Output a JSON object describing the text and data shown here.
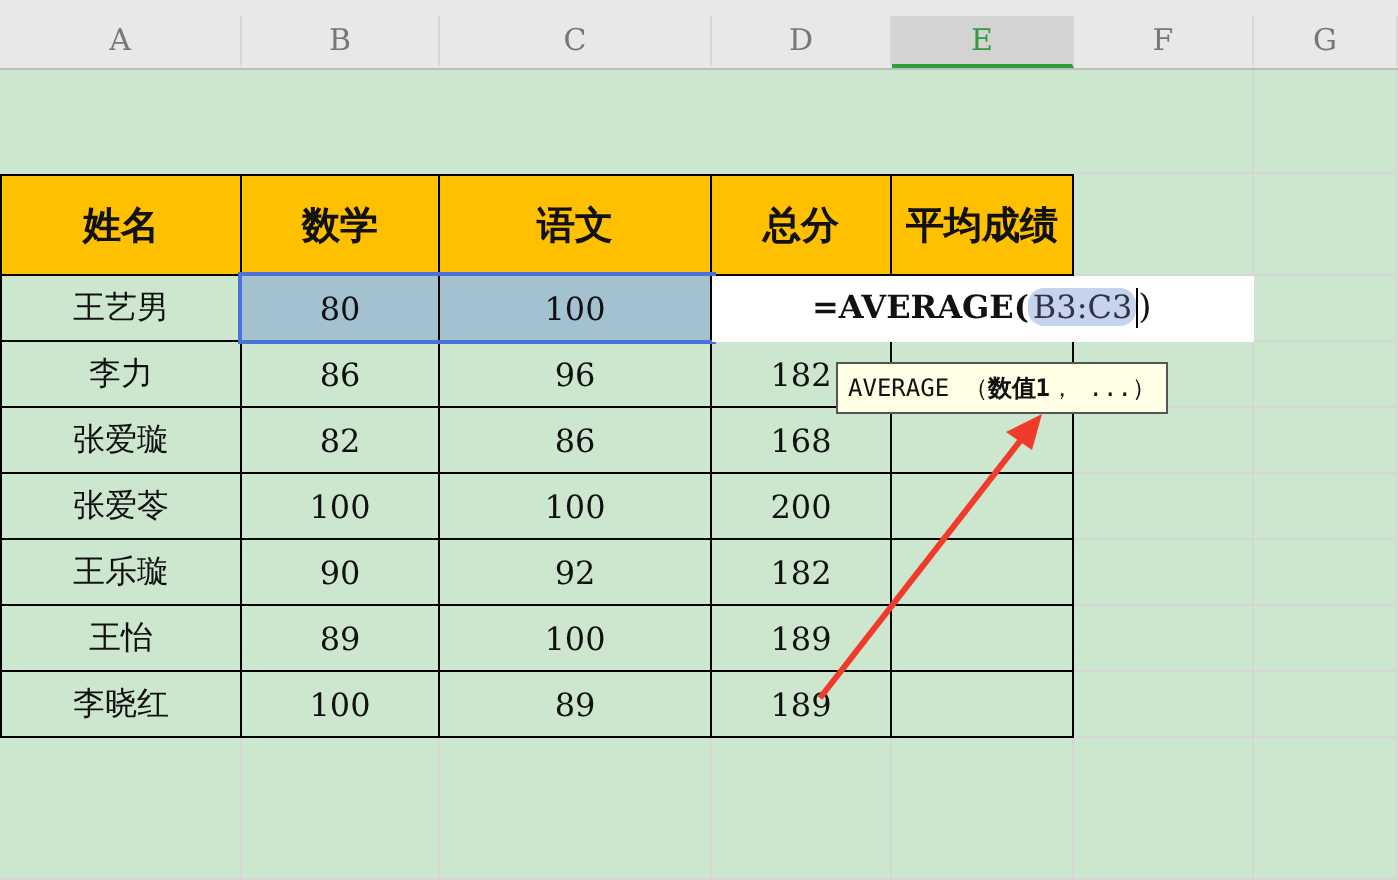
{
  "column_headers": [
    {
      "label": "A",
      "selected": false
    },
    {
      "label": "B",
      "selected": false
    },
    {
      "label": "C",
      "selected": false
    },
    {
      "label": "D",
      "selected": false
    },
    {
      "label": "E",
      "selected": true
    },
    {
      "label": "F",
      "selected": false
    },
    {
      "label": "G",
      "selected": false
    }
  ],
  "table": {
    "header": [
      "姓名",
      "数学",
      "语文",
      "总分",
      "平均成绩"
    ],
    "rows": [
      {
        "cells": [
          {
            "text": "王艺男",
            "selected": false
          },
          {
            "text": "80",
            "selected": true
          },
          {
            "text": "100",
            "selected": true
          }
        ]
      },
      {
        "cells": [
          {
            "text": "李力",
            "selected": false
          },
          {
            "text": "86",
            "selected": false
          },
          {
            "text": "96",
            "selected": false
          },
          {
            "text": "182",
            "selected": false
          }
        ]
      },
      {
        "cells": [
          {
            "text": "张爱璇",
            "selected": false
          },
          {
            "text": "82",
            "selected": false
          },
          {
            "text": "86",
            "selected": false
          },
          {
            "text": "168",
            "selected": false
          }
        ]
      },
      {
        "cells": [
          {
            "text": "张爱苓",
            "selected": false
          },
          {
            "text": "100",
            "selected": false
          },
          {
            "text": "100",
            "selected": false
          },
          {
            "text": "200",
            "selected": false
          }
        ]
      },
      {
        "cells": [
          {
            "text": "王乐璇",
            "selected": false
          },
          {
            "text": "90",
            "selected": false
          },
          {
            "text": "92",
            "selected": false
          },
          {
            "text": "182",
            "selected": false
          }
        ]
      },
      {
        "cells": [
          {
            "text": "王怡",
            "selected": false
          },
          {
            "text": "89",
            "selected": false
          },
          {
            "text": "100",
            "selected": false
          },
          {
            "text": "189",
            "selected": false
          }
        ]
      },
      {
        "cells": [
          {
            "text": "李晓红",
            "selected": false
          },
          {
            "text": "100",
            "selected": false
          },
          {
            "text": "89",
            "selected": false
          },
          {
            "text": "189",
            "selected": false
          }
        ]
      }
    ]
  },
  "formula_editor": {
    "prefix": "=AVERAGE(",
    "reference": "B3:C3",
    "suffix": ")"
  },
  "tooltip": "AVERAGE （**数值1**， ...）"
}
